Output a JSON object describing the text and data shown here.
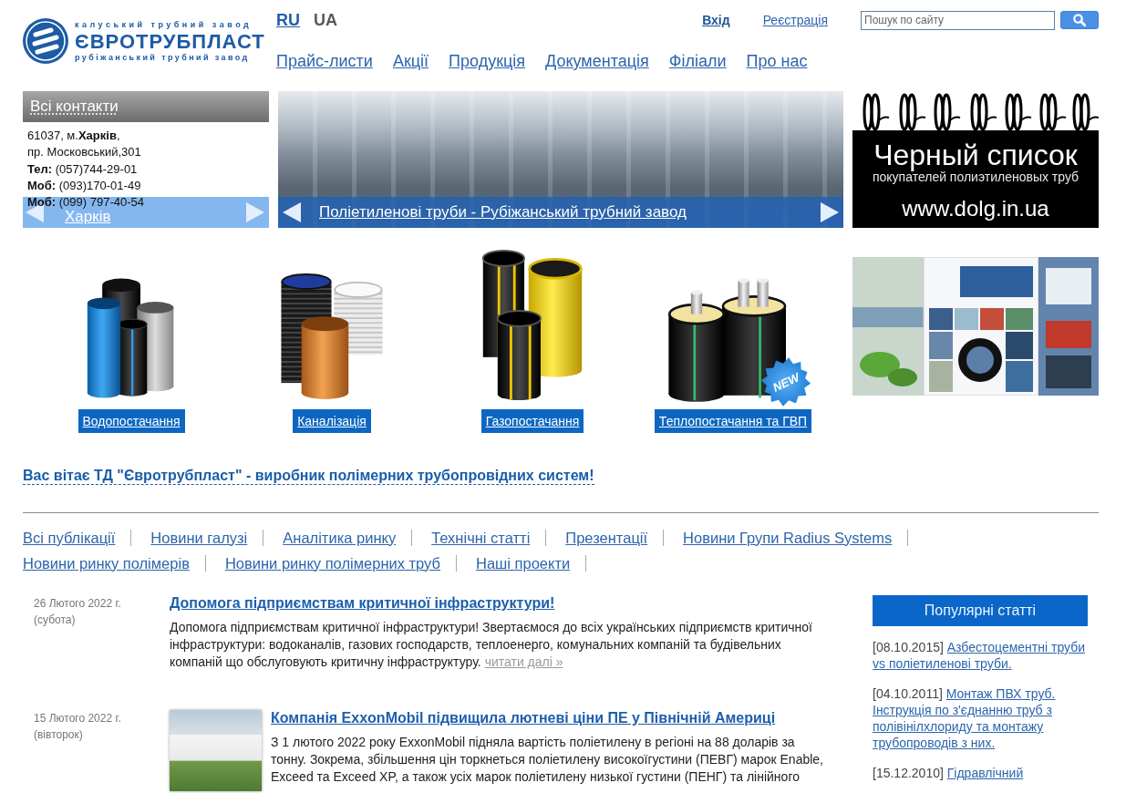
{
  "header": {
    "logo": {
      "top_line": "калуський трубний завод",
      "name": "ЄВРОТРУБПЛАСТ",
      "bottom_line": "рубіжанський трубний завод"
    },
    "languages": [
      {
        "label": "RU",
        "selected": false
      },
      {
        "label": "UA",
        "selected": true
      }
    ],
    "login": "Вхід",
    "register": "Реєстрація",
    "search": {
      "placeholder": "Пошук по сайту"
    },
    "nav": [
      "Прайс-листи",
      "Акції",
      "Продукція",
      "Документація",
      "Філіали",
      "Про нас"
    ]
  },
  "contacts": {
    "title": "Всі контакти",
    "lines": [
      "61037, м.**Харків**,",
      "пр. Московський,301",
      "**Тел:** (057)744-29-01",
      "**Моб:** (093)170-01-49",
      "**Моб:** (099) 797-40-54"
    ],
    "city": "Харків"
  },
  "slider": {
    "caption": "Поліетиленові труби - Рубіжанський трубний завод"
  },
  "blacklist_banner": {
    "title": "Черный список",
    "subtitle": "покупателей полиэтиленовых труб",
    "url": "www.dolg.in.ua"
  },
  "products": [
    {
      "kind": "water",
      "label": "Водопостачання"
    },
    {
      "kind": "sewer",
      "label": "Каналізація"
    },
    {
      "kind": "gas",
      "label": "Газопостачання"
    },
    {
      "kind": "heating",
      "label": "Теплопостачання та ГВП",
      "badge": "NEW"
    }
  ],
  "welcome": "Вас вітає ТД \"Євротрубпласт\" - виробник полімерних трубопровідних систем!",
  "publication_tabs": [
    "Всі публікації",
    "Новини галузі",
    "Аналітика ринку",
    "Технічні статті",
    "Презентації",
    "Новини Групи Radius Systems",
    "Новини ринку полімерів",
    "Новини ринку полімерних труб",
    "Наші проекти"
  ],
  "news": [
    {
      "date": "26 Лютого 2022 г.",
      "weekday": "(субота)",
      "photo": false,
      "title": "Допомога підприємствам критичної інфраструктури!",
      "body": "Допомога підприємствам критичної інфраструктури! Звертаємося до всіх українських підприємств критичної інфраструктури: водоканалів, газових господарств, теплоенерго, комунальних компаній та будівельних компаній що обслуговують критичну інфраструктуру.",
      "more": "читати далі »"
    },
    {
      "date": "15 Лютого 2022 г.",
      "weekday": "(вівторок)",
      "photo": true,
      "title": "Компанія ExxonMobil підвищила лютневі ціни ПЕ у Північній Америці",
      "body": "З 1 лютого 2022 року ExxonMobil підняла вартість поліетилену в регіоні на 88 доларів за тонну. Зокрема, збільшення цін торкнеться поліетилену високоїгустини (ПЕВГ) марок Enable, Exceed та Exceed XP, а також усіх марок поліетилену низької густини (ПЕНГ) та лінійного"
    }
  ],
  "popular": {
    "title": "Популярні статті",
    "items": [
      {
        "date": "[08.10.2015]",
        "title": "Азбестоцементні труби vs поліетиленові труби."
      },
      {
        "date": "[04.10.2011]",
        "title": "Монтаж ПВХ труб. Інструкція по з'єднанню труб з полівінілхлориду та монтажу трубопроводів з них."
      },
      {
        "date": "[15.12.2010]",
        "title": "Гідравлічний"
      }
    ]
  }
}
